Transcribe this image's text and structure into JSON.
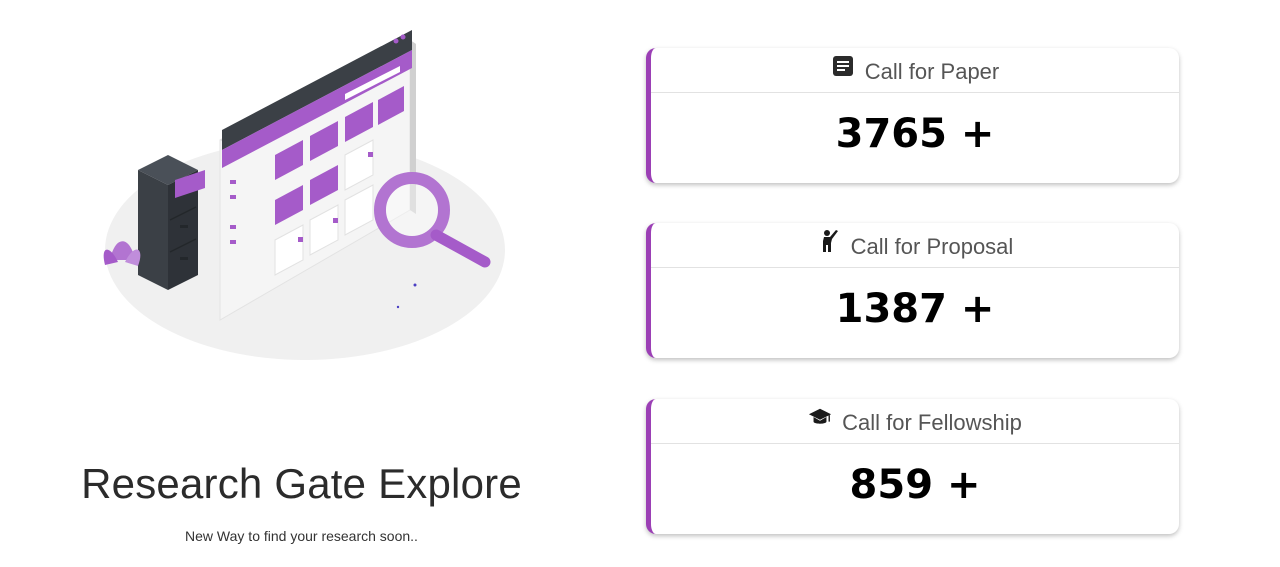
{
  "hero": {
    "title": "Research Gate Explore",
    "subtitle": "New Way to find your research soon.."
  },
  "cards": [
    {
      "icon": "document-icon",
      "label": "Call for Paper",
      "value": "3765 +"
    },
    {
      "icon": "person-raising-hand-icon",
      "label": "Call for Proposal",
      "value": "1387 +"
    },
    {
      "icon": "graduation-cap-icon",
      "label": "Call for Fellowship",
      "value": "859 +"
    }
  ],
  "colors": {
    "accent": "#9b3fb5",
    "illustration_purple": "#a55bc9",
    "illustration_dark": "#3b4046"
  }
}
